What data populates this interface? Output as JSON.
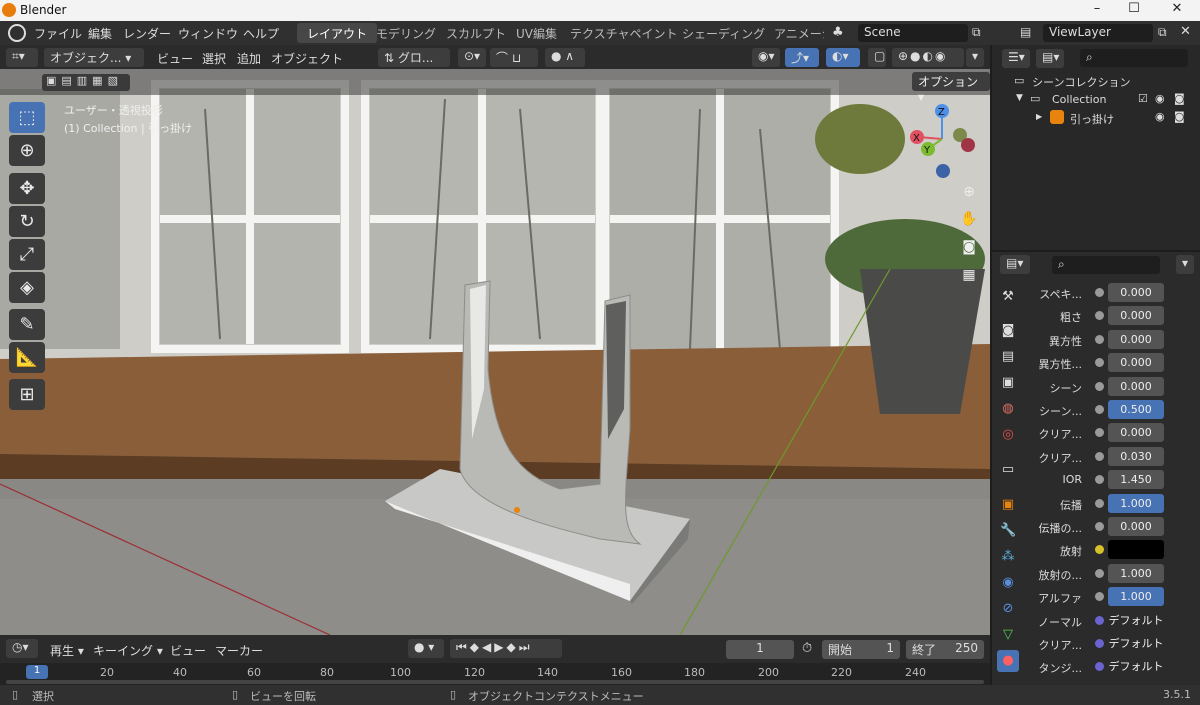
{
  "window": {
    "app_title": "Blender",
    "version": "3.5.1"
  },
  "top_menu": [
    "ファイル",
    "編集",
    "レンダー",
    "ウィンドウ",
    "ヘルプ"
  ],
  "workspaces": [
    {
      "label": "レイアウト",
      "active": true
    },
    {
      "label": "モデリング",
      "active": false
    },
    {
      "label": "スカルプト",
      "active": false
    },
    {
      "label": "UV編集",
      "active": false
    },
    {
      "label": "テクスチャペイント",
      "active": false
    },
    {
      "label": "シェーディング",
      "active": false
    },
    {
      "label": "アニメーシ",
      "active": false
    }
  ],
  "scene": {
    "name": "Scene",
    "view_layer": "ViewLayer"
  },
  "viewport_header": {
    "mode": "オブジェク...",
    "menus": [
      "ビュー",
      "選択",
      "追加",
      "オブジェクト"
    ],
    "transform_orientation": "グロ...",
    "options_label": "オプション"
  },
  "viewport": {
    "view_name": "ユーザー・透視投影",
    "collection_info": "(1) Collection | 引っ掛け",
    "gizmo": {
      "x": "X",
      "y": "Y",
      "z": "Z"
    }
  },
  "toolbar_icons": [
    "select-box-icon",
    "cursor-icon",
    "move-icon",
    "rotate-icon",
    "scale-icon",
    "transform-icon",
    "annotate-icon",
    "measure-icon",
    "add-cube-icon"
  ],
  "outliner": {
    "root": "シーンコレクション",
    "collection": "Collection",
    "object": "引っ掛け"
  },
  "properties": {
    "rows": [
      {
        "label": "スペキ...",
        "value": "0.000",
        "style": "gray",
        "dot": "gray"
      },
      {
        "label": "粗さ",
        "value": "0.000",
        "style": "gray",
        "dot": "gray"
      },
      {
        "label": "異方性",
        "value": "0.000",
        "style": "gray",
        "dot": "gray"
      },
      {
        "label": "異方性...",
        "value": "0.000",
        "style": "gray",
        "dot": "gray"
      },
      {
        "label": "シーン",
        "value": "0.000",
        "style": "gray",
        "dot": "gray"
      },
      {
        "label": "シーン...",
        "value": "0.500",
        "style": "blue",
        "dot": "gray"
      },
      {
        "label": "クリア...",
        "value": "0.000",
        "style": "gray",
        "dot": "gray"
      },
      {
        "label": "クリア...",
        "value": "0.030",
        "style": "gray",
        "dot": "gray"
      },
      {
        "label": "IOR",
        "value": "1.450",
        "style": "gray",
        "dot": "gray"
      },
      {
        "label": "伝播",
        "value": "1.000",
        "style": "blue",
        "dot": "gray"
      },
      {
        "label": "伝播の...",
        "value": "0.000",
        "style": "gray",
        "dot": "gray"
      },
      {
        "label": "放射",
        "value": "",
        "style": "black",
        "dot": "yellow"
      },
      {
        "label": "放射の...",
        "value": "1.000",
        "style": "gray",
        "dot": "gray"
      },
      {
        "label": "アルファ",
        "value": "1.000",
        "style": "blue",
        "dot": "gray"
      },
      {
        "label": "ノーマル",
        "value": "デフォルト",
        "style": "link",
        "dot": "purple"
      },
      {
        "label": "クリア...",
        "value": "デフォルト",
        "style": "link",
        "dot": "purple"
      },
      {
        "label": "タンジ...",
        "value": "デフォルト",
        "style": "link",
        "dot": "purple"
      }
    ]
  },
  "timeline": {
    "menus": [
      "再生",
      "キーイング",
      "ビュー",
      "マーカー"
    ],
    "current_frame": "1",
    "start_label": "開始",
    "start": "1",
    "end_label": "終了",
    "end": "250",
    "ruler": [
      "1",
      "20",
      "40",
      "60",
      "80",
      "100",
      "120",
      "140",
      "160",
      "180",
      "200",
      "220",
      "240"
    ]
  },
  "statusbar": {
    "select": "選択",
    "rotate": "ビューを回転",
    "context": "オブジェクトコンテクストメニュー"
  },
  "colors": {
    "accent": "#4772b3",
    "header": "#303030",
    "panel": "#2b2b2b",
    "active_workspace": "#474747"
  }
}
